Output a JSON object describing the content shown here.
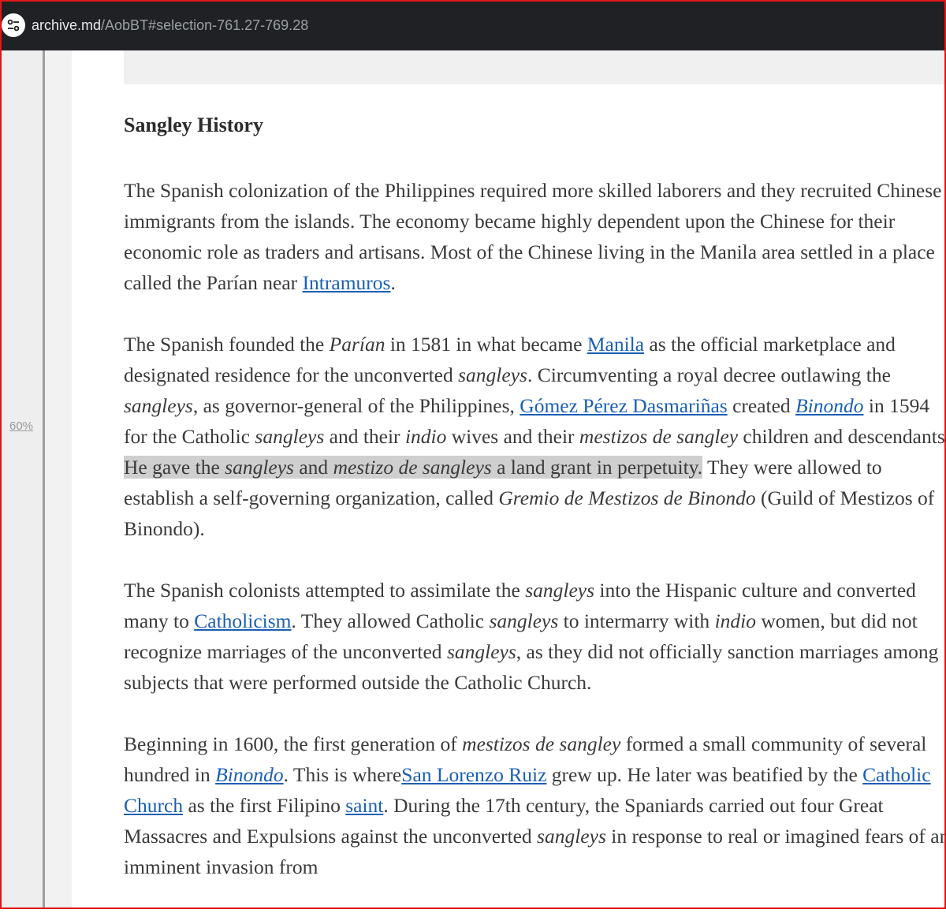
{
  "browser": {
    "url_host": "archive.md",
    "url_path": "/AobBT#selection-761.27-769.28",
    "site_icon": "tune-icon"
  },
  "sidebar": {
    "zoom_label": "60%"
  },
  "article": {
    "heading": "Sangley History",
    "p1": {
      "t1": "The Spanish colonization of the Philippines required more skilled laborers and they recruited Chinese immigrants from the islands. The economy became highly dependent upon the Chinese for their economic role as traders and artisans. Most of the Chinese living in the Manila area settled in a place called the Parían near ",
      "link_intramuros": "Intramuros",
      "t2": "."
    },
    "p2": {
      "t1": "The Spanish founded the ",
      "em_parian": "Parían",
      "t2": " in 1581 in what became ",
      "link_manila": "Manila",
      "t3": " as the official marketplace and designated residence for the unconverted ",
      "em_sangleys_1": "sangleys",
      "t4": ". Circumventing a royal decree outlawing the ",
      "em_sangleys_2": "sangleys",
      "t5": ", as governor-general of the Philippines, ",
      "link_gomez": "Gómez Pérez Dasmariñas",
      "t6": " created ",
      "link_binondo": "Binondo",
      "t7": " in 1594 for the Catholic ",
      "em_sangleys_3": "sangleys",
      "t8": " and their ",
      "em_indio": "indio",
      "t9": " wives and their ",
      "em_mestizos": "mestizos de sangley",
      "t10": " children and descendants. ",
      "hl_1": "He gave the ",
      "hl_em_sangleys": "sangleys",
      "hl_2": " and ",
      "hl_em_mestizo": "mestizo de sangleys",
      "hl_3": " a land grant in perpetuity.",
      "t11": " They were allowed to establish a self-governing organization, called ",
      "em_gremio": "Gremio de Mestizos de Binondo",
      "t12": " (Guild of Mestizos of Binondo)."
    },
    "p3": {
      "t1": "The Spanish colonists attempted to assimilate the ",
      "em_sangleys_1": "sangleys",
      "t2": " into the Hispanic culture and converted many to ",
      "link_catholicism": "Catholicism",
      "t3": ". They allowed Catholic ",
      "em_sangleys_2": "sangleys",
      "t4": " to intermarry with ",
      "em_indio": "indio",
      "t5": " women, but did not recognize marriages of the unconverted ",
      "em_sangleys_3": "sangleys",
      "t6": ", as they did not officially sanction marriages among subjects that were performed outside the Catholic Church."
    },
    "p4": {
      "t1": "Beginning in 1600, the first generation of ",
      "em_mestizos": "mestizos de sangley",
      "t2": " formed a small community of several hundred in ",
      "link_binondo": "Binondo",
      "t3": ". This is where",
      "link_lorenzo": "San Lorenzo Ruiz",
      "t4": " grew up. He later was beatified by the ",
      "link_church": "Catholic Church",
      "t5": " as the first Filipino ",
      "link_saint": "saint",
      "t6": ". During the 17th century, the Spaniards carried out four Great Massacres and Expulsions against the unconverted ",
      "em_sangleys": "sangleys",
      "t7": " in response to real or imagined fears of an imminent invasion from"
    }
  }
}
